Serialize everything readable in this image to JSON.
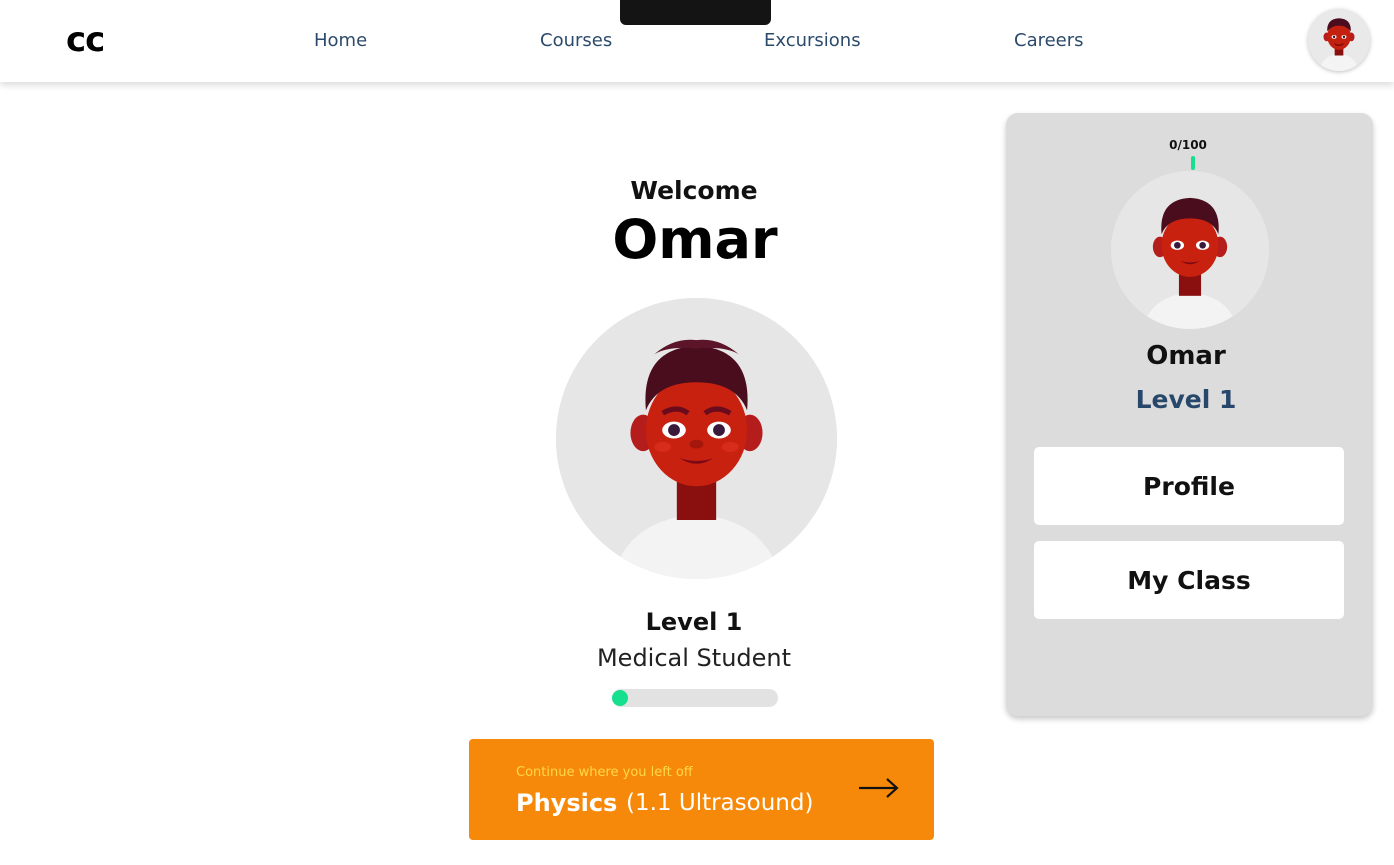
{
  "app": {
    "logo": "cc"
  },
  "nav": {
    "items": [
      {
        "label": "Home"
      },
      {
        "label": "Courses"
      },
      {
        "label": "Excursions"
      },
      {
        "label": "Careers"
      }
    ]
  },
  "welcome": {
    "greeting": "Welcome",
    "name": "Omar"
  },
  "student": {
    "level": "Level 1",
    "role": "Medical Student",
    "xp_progress_fraction": 0.0
  },
  "continue": {
    "hint": "Continue where you left off",
    "subject": "Physics",
    "lesson": "(1.1 Ultrasound)",
    "icon": "arrow-right-icon"
  },
  "panel": {
    "xp_count": "0/100",
    "name": "Omar",
    "level": "Level 1",
    "buttons": [
      {
        "label": "Profile"
      },
      {
        "label": "My Class"
      }
    ]
  },
  "colors": {
    "accent_orange": "#f7890a",
    "progress_green": "#16e08e",
    "nav_text": "#2c4a6b",
    "level_blue": "#27486a",
    "panel_bg": "#dcdcdc"
  }
}
